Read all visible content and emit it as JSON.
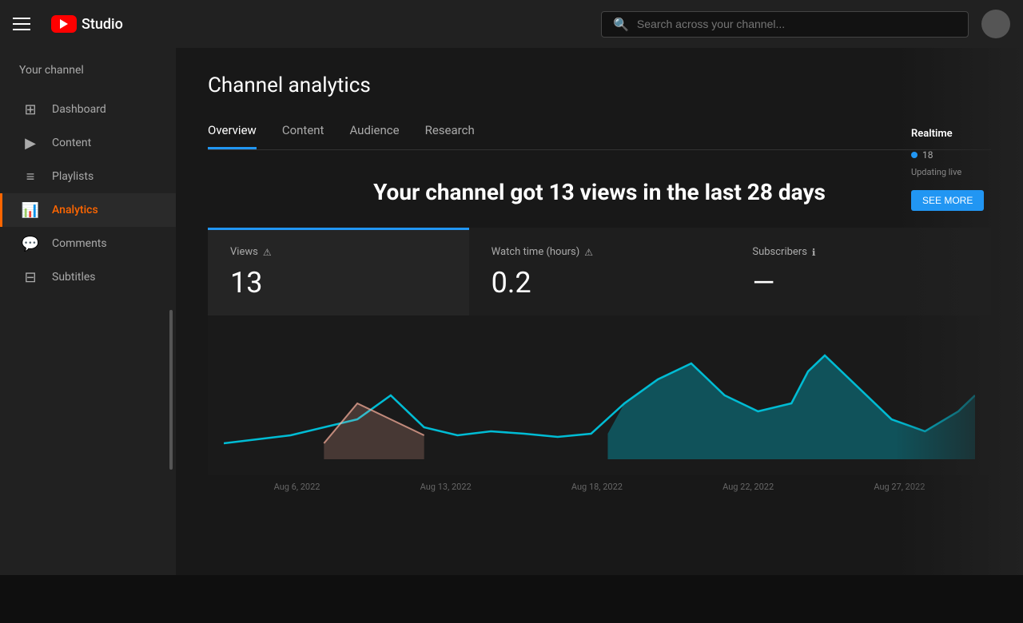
{
  "header": {
    "menu_icon": "☰",
    "logo_text": "Studio",
    "search_placeholder": "Search across your channel...",
    "title": "Channel analytics"
  },
  "sidebar": {
    "channel_label": "Your channel",
    "items": [
      {
        "id": "dashboard",
        "label": "Dashboard",
        "icon": "⊞",
        "active": false
      },
      {
        "id": "content",
        "label": "Content",
        "icon": "▶",
        "active": false
      },
      {
        "id": "playlists",
        "label": "Playlists",
        "icon": "≡",
        "active": false
      },
      {
        "id": "analytics",
        "label": "Analytics",
        "icon": "📊",
        "active": true
      },
      {
        "id": "comments",
        "label": "Comments",
        "icon": "💬",
        "active": false
      },
      {
        "id": "subtitles",
        "label": "Subtitles",
        "icon": "⊟",
        "active": false
      }
    ]
  },
  "tabs": [
    {
      "id": "overview",
      "label": "Overview",
      "active": true
    },
    {
      "id": "content",
      "label": "Content",
      "active": false
    },
    {
      "id": "audience",
      "label": "Audience",
      "active": false
    },
    {
      "id": "research",
      "label": "Research",
      "active": false
    }
  ],
  "hero": {
    "text": "Your channel got 13 views in the last 28 days"
  },
  "metrics": [
    {
      "id": "views",
      "label": "Views",
      "value": "13",
      "active": true
    },
    {
      "id": "watch_time",
      "label": "Watch time (hours)",
      "value": "0.2",
      "active": false
    },
    {
      "id": "subscribers",
      "label": "Subscribers",
      "value": "—",
      "active": false
    }
  ],
  "chart": {
    "labels": [
      "Aug 6, 2022",
      "Aug 13, 2022",
      "Aug 18, 2022",
      "Aug 22, 2022",
      "Aug 27, 2022"
    ]
  },
  "right_panel": {
    "title": "Realtime",
    "sub": "Updating live",
    "button_label": "SEE MORE",
    "items": [
      "18",
      "—"
    ]
  }
}
